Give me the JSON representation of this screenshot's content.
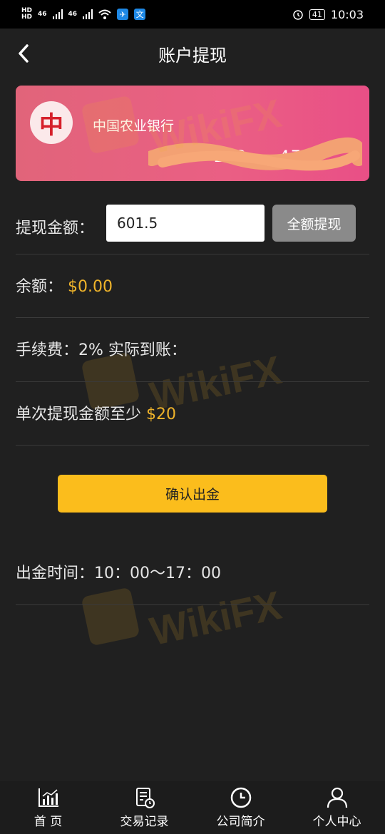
{
  "status_bar": {
    "hd1": "HD",
    "hd2": "HD",
    "sig1": "46",
    "sig2": "46",
    "app1_icon": "share-app-icon",
    "app2_icon": "translate-app-icon",
    "app2_glyph": "文",
    "battery": "41",
    "time": "10:03"
  },
  "header": {
    "title": "账户提现",
    "back_icon": "chevron-left-icon"
  },
  "bank_card": {
    "logo_text": "中",
    "bank_name": "中国农业银行",
    "card_number_visible": "62 ··· 123 ··· 470",
    "gradient_start": "#e1647a",
    "gradient_end": "#e94f86"
  },
  "withdraw": {
    "amount_label": "提现金额：",
    "amount_value": "601.5",
    "all_button": "全额提现",
    "balance_label": "余额：",
    "balance_value": "$0.00",
    "fee_text": "手续费：2% 实际到账：",
    "min_label": "单次提现金额至少",
    "min_value": "$20",
    "confirm_button": "确认出金",
    "time_text": "出金时间：10：00～17：00"
  },
  "watermark_text": "WikiFX",
  "tabs": [
    {
      "label": "首 页",
      "icon": "chart-icon"
    },
    {
      "label": "交易记录",
      "icon": "document-clock-icon"
    },
    {
      "label": "公司简介",
      "icon": "clock-icon"
    },
    {
      "label": "个人中心",
      "icon": "user-icon"
    }
  ],
  "colors": {
    "accent": "#fbbd1c",
    "gold_text": "#f0b42a",
    "background": "#202020"
  }
}
